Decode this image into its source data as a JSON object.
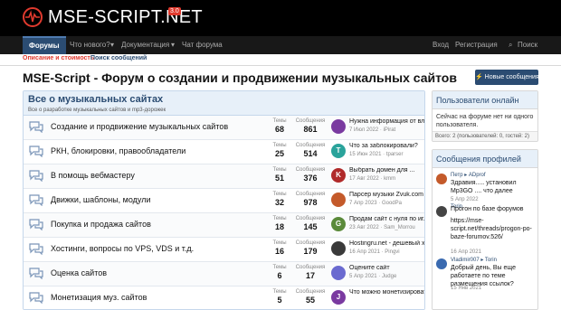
{
  "header": {
    "logo_text": "MSE-SCRIPT.NET",
    "version_badge": "3.0",
    "brand_color": "#e03a2e"
  },
  "nav": {
    "items": [
      {
        "label": "Форумы",
        "active": true
      },
      {
        "label": "Что нового?"
      },
      {
        "label": "Документация"
      },
      {
        "label": "Чат форума"
      }
    ],
    "login": "Вход",
    "register": "Регистрация",
    "search": "Поиск"
  },
  "subnav": {
    "pricing": "Описание и стоимость",
    "find_posts": "Поиск сообщений"
  },
  "page": {
    "title": "MSE-Script - Форум о создании и продвижении музыкальных сайтов",
    "new_posts_button": "Новые сообщения"
  },
  "category": {
    "title": "Все о музыкальных сайтах",
    "description": "Все о разработке музыкальных сайтов и mp3-дорожек",
    "col_threads": "Темы",
    "col_posts": "Сообщения",
    "forums": [
      {
        "title": "Создание и продвижение музыкальных сайтов",
        "threads": "68",
        "posts": "861",
        "avatar_letter": "",
        "avatar_color": "#7a3aa0",
        "last_title": "Нужна информация от владельц...",
        "last_date": "7 Июл 2022",
        "last_user": "iPirat"
      },
      {
        "title": "РКН, блокировки, правообладатели",
        "threads": "25",
        "posts": "514",
        "avatar_letter": "T",
        "avatar_color": "#2aa39b",
        "last_title": "Что за заблокировали?",
        "last_date": "15 Июн 2021",
        "last_user": "tparser"
      },
      {
        "title": "В помощь вебмастеру",
        "threads": "51",
        "posts": "376",
        "avatar_letter": "K",
        "avatar_color": "#b02a2a",
        "last_title": "Выбрать домен для ...",
        "last_date": "17 Авг 2022",
        "last_user": "kmm"
      },
      {
        "title": "Движки, шаблоны, модули",
        "threads": "32",
        "posts": "978",
        "avatar_letter": "",
        "avatar_color": "#c45a2a",
        "last_title": "Парсер музыки Zvuk.com + парс...",
        "last_date": "7 Апр 2023",
        "last_user": "GoodPa"
      },
      {
        "title": "Покупка и продажа сайтов",
        "threads": "18",
        "posts": "145",
        "avatar_letter": "G",
        "avatar_color": "#5a8a3a",
        "last_title": "Продам сайт с нуля по иг...",
        "last_date": "23 Авг 2022",
        "last_user": "Sam_Morrou"
      },
      {
        "title": "Хостинги, вопросы по VPS, VDS и т.д.",
        "threads": "16",
        "posts": "179",
        "avatar_letter": "",
        "avatar_color": "#3a3a3a",
        "last_title": "Hostingru.net - дешевый хостинг...",
        "last_date": "16 Апр 2021",
        "last_user": "Pingvi"
      },
      {
        "title": "Оценка сайтов",
        "threads": "6",
        "posts": "17",
        "avatar_letter": "",
        "avatar_color": "#6a6ad0",
        "last_title": "Оцените сайт",
        "last_date": "5 Апр 2021",
        "last_user": "Judge"
      },
      {
        "title": "Монетизация муз. сайтов",
        "threads": "5",
        "posts": "55",
        "avatar_letter": "J",
        "avatar_color": "#7a3aa0",
        "last_title": "Что можно монетизировать andr...",
        "last_date": "",
        "last_user": ""
      }
    ]
  },
  "online": {
    "title": "Пользователи онлайн",
    "text": "Сейчас на форуме нет ни одного пользователя.",
    "total": "Всего: 2 (пользователей: 0, гостей: 2)"
  },
  "profile_posts": {
    "title": "Сообщения профилей",
    "items": [
      {
        "users": "Петр ▸ ADprof",
        "text": "Здравия..... установил Mp3GO .... что далее",
        "date": "5 Апр 2022",
        "avatar_color": "#c45a2a"
      },
      {
        "users": "Torin",
        "text": "Прогон по базе форумов",
        "date": "",
        "avatar_color": "#444444"
      },
      {
        "users": "",
        "text": "https://mse-script.net/threads/progon-po-baze-forumov.526/",
        "date": "16 Апр 2021",
        "avatar_color": ""
      },
      {
        "users": "Vladimir007 ▸ Torin",
        "text": "Добрый день, Вы еще работаете по теме размещения ссылок?",
        "date": "15 Янв 2021",
        "avatar_color": "#3a6ab0"
      }
    ]
  }
}
